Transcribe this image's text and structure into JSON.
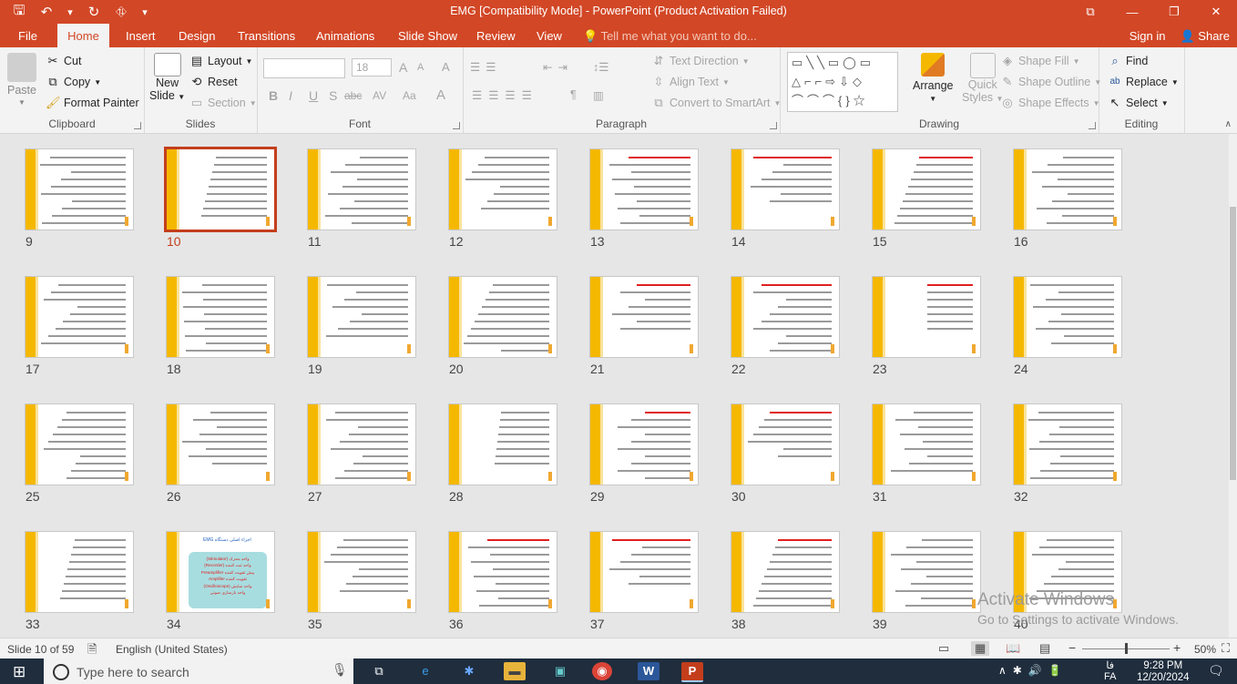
{
  "window": {
    "title": "EMG [Compatibility Mode] - PowerPoint (Product Activation Failed)",
    "controls": [
      "⧉",
      "—",
      "❐",
      "✕"
    ]
  },
  "qat": {
    "save": "🖫",
    "undo": "↶",
    "undo_drop": "▾",
    "redo": "↻",
    "present": "⛗",
    "customize": "▾"
  },
  "tabs": [
    "File",
    "Home",
    "Insert",
    "Design",
    "Transitions",
    "Animations",
    "Slide Show",
    "Review",
    "View"
  ],
  "active_tab": "Home",
  "tell_me": "Tell me what you want to do...",
  "sign_in": "Sign in",
  "share": "Share",
  "ribbon": {
    "clipboard": {
      "label": "Clipboard",
      "paste": "Paste",
      "cut": "Cut",
      "copy": "Copy",
      "format_painter": "Format Painter"
    },
    "slides": {
      "label": "Slides",
      "new_slide_1": "New",
      "new_slide_2": "Slide",
      "layout": "Layout",
      "reset": "Reset",
      "section": "Section"
    },
    "font": {
      "label": "Font",
      "font_size": "18",
      "bold": "B",
      "italic": "I",
      "underline": "U",
      "shadow": "S",
      "strike": "abc",
      "spacing": "AV",
      "case": "Aa",
      "color": "A",
      "grow": "A",
      "shrink": "A",
      "clear": "A"
    },
    "paragraph": {
      "label": "Paragraph",
      "text_direction": "Text Direction",
      "align_text": "Align Text",
      "convert_smartart": "Convert to SmartArt"
    },
    "drawing": {
      "label": "Drawing",
      "arrange": "Arrange",
      "quick_styles_1": "Quick",
      "quick_styles_2": "Styles",
      "shape_fill": "Shape Fill",
      "shape_outline": "Shape Outline",
      "shape_effects": "Shape Effects"
    },
    "editing": {
      "label": "Editing",
      "find": "Find",
      "replace": "Replace",
      "select": "Select"
    }
  },
  "slides": [
    {
      "n": "9"
    },
    {
      "n": "10"
    },
    {
      "n": "11"
    },
    {
      "n": "12"
    },
    {
      "n": "13"
    },
    {
      "n": "14"
    },
    {
      "n": "15"
    },
    {
      "n": "16"
    },
    {
      "n": "17"
    },
    {
      "n": "18"
    },
    {
      "n": "19"
    },
    {
      "n": "20"
    },
    {
      "n": "21"
    },
    {
      "n": "22"
    },
    {
      "n": "23"
    },
    {
      "n": "24"
    },
    {
      "n": "25"
    },
    {
      "n": "26"
    },
    {
      "n": "27"
    },
    {
      "n": "28"
    },
    {
      "n": "29"
    },
    {
      "n": "30"
    },
    {
      "n": "31"
    },
    {
      "n": "32"
    },
    {
      "n": "33"
    },
    {
      "n": "34"
    },
    {
      "n": "35"
    },
    {
      "n": "36"
    },
    {
      "n": "37"
    },
    {
      "n": "38"
    },
    {
      "n": "39"
    },
    {
      "n": "40"
    }
  ],
  "selected_slide": "10",
  "slide_34_lines": [
    "(Stimulator) واحد محرک",
    "(Recorder) واحد ثبت کننده",
    "Preamplifier پیش تقویت کننده",
    "Amplifier تقویت کننده",
    "(Oscilloscope) واحد نمایش",
    "واحد بازسازی صوتی"
  ],
  "slide_34_title": "اجزاء اصلی دستگاه EMG",
  "watermark": {
    "line1": "Activate Windows",
    "line2": "Go to Settings to activate Windows."
  },
  "status": {
    "slide_info": "Slide 10 of 59",
    "language": "English (United States)",
    "zoom": "50%",
    "zoom_level": 0.5
  },
  "taskbar": {
    "search_placeholder": "Type here to search",
    "time": "9:28 PM",
    "date": "12/20/2024",
    "lang": "FA",
    "lang_label": "فا"
  }
}
